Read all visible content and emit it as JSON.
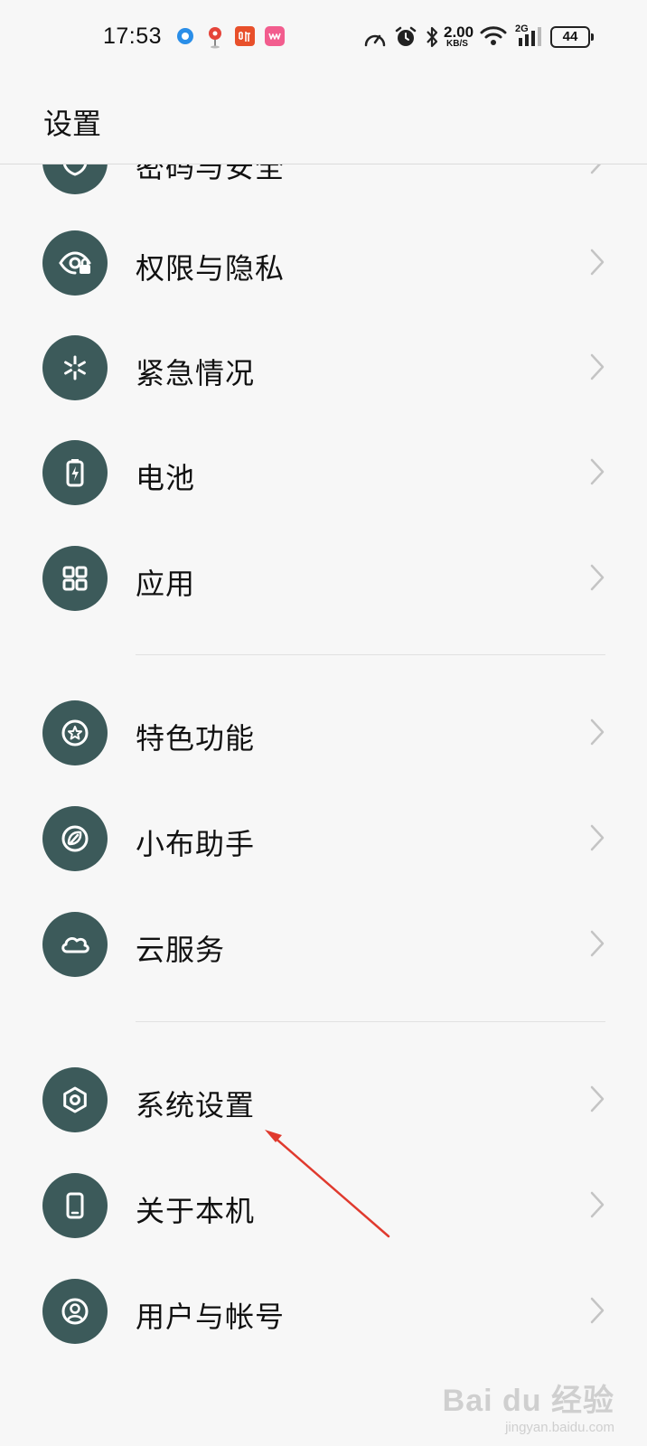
{
  "status_bar": {
    "time": "17:53",
    "network_speed_value": "2.00",
    "network_speed_unit": "KB/S",
    "signal_type": "2G",
    "battery": "44"
  },
  "header": {
    "title": "设置"
  },
  "settings": [
    {
      "label": "密码与安全",
      "icon": "shield-icon"
    },
    {
      "label": "权限与隐私",
      "icon": "privacy-eye-lock-icon"
    },
    {
      "label": "紧急情况",
      "icon": "emergency-asterisk-icon"
    },
    {
      "label": "电池",
      "icon": "battery-icon"
    },
    {
      "label": "应用",
      "icon": "apps-grid-icon"
    },
    {
      "label": "特色功能",
      "icon": "star-circle-icon"
    },
    {
      "label": "小布助手",
      "icon": "assistant-icon"
    },
    {
      "label": "云服务",
      "icon": "cloud-icon"
    },
    {
      "label": "系统设置",
      "icon": "hexagon-settings-icon"
    },
    {
      "label": "关于本机",
      "icon": "phone-icon"
    },
    {
      "label": "用户与帐号",
      "icon": "user-circle-icon"
    }
  ],
  "colors": {
    "icon_background": "#3c5a5a",
    "page_background": "#f7f7f7",
    "annotation_arrow": "#e03a2e"
  },
  "watermark": {
    "brand": "Bai du 经验",
    "url": "jingyan.baidu.com"
  }
}
